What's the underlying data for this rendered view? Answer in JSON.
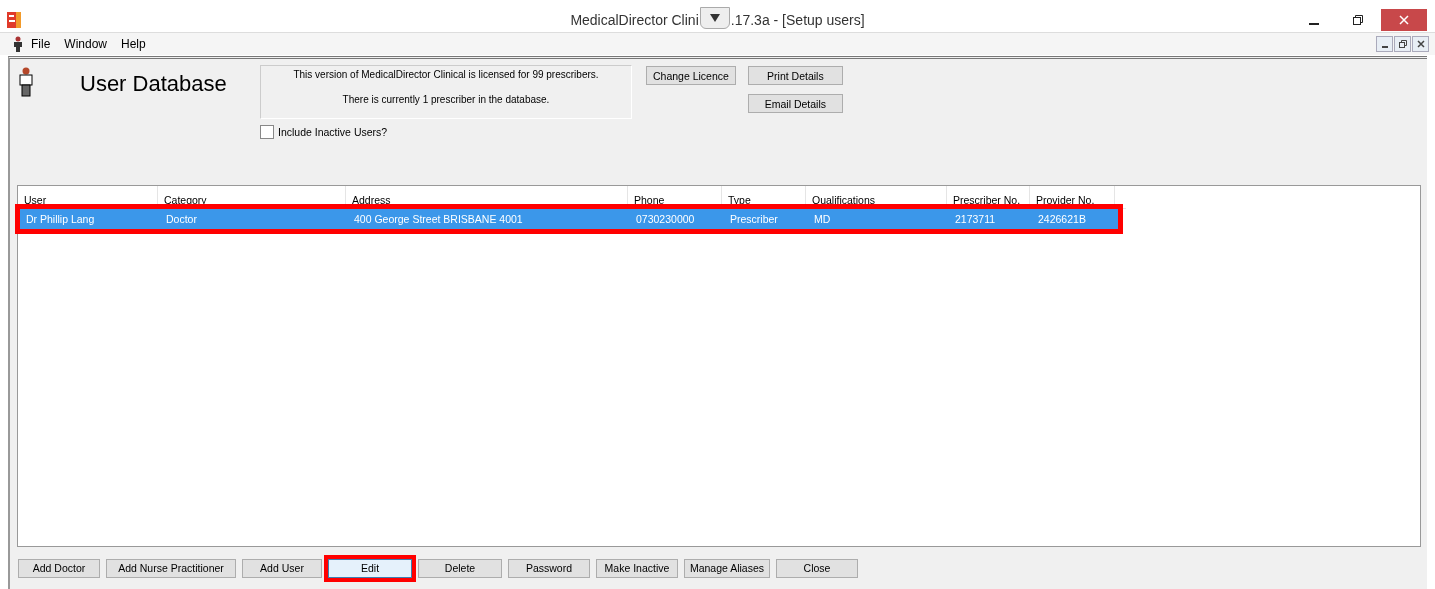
{
  "window": {
    "title_start": "MedicalDirector Clini",
    "title_end": ".17.3a - [Setup users]"
  },
  "menu": [
    "File",
    "Window",
    "Help"
  ],
  "header": {
    "title": "User Database",
    "licence_lines": [
      "This version of MedicalDirector Clinical is licensed for 99 prescribers.",
      "There is currently 1 prescriber in the database."
    ],
    "include_inactive": {
      "label": "Include Inactive Users?",
      "checked": false
    },
    "buttons": [
      "Change Licence",
      "Print Details",
      "Email Details"
    ]
  },
  "table": {
    "columns": [
      "User",
      "Category",
      "Address",
      "Phone",
      "Type",
      "Qualifications",
      "Prescriber No.",
      "Provider No."
    ],
    "rows": [
      {
        "cells": [
          "Dr Phillip Lang",
          "Doctor",
          "400 George Street  BRISBANE  4001",
          "0730230000",
          "Prescriber",
          "MD",
          "2173711",
          "2426621B"
        ],
        "selected": true,
        "highlighted": true
      }
    ]
  },
  "buttons": [
    {
      "label": "Add Doctor",
      "focused": false,
      "highlighted": false
    },
    {
      "label": "Add Nurse Practitioner",
      "focused": false,
      "highlighted": false
    },
    {
      "label": "Add User",
      "focused": false,
      "highlighted": false
    },
    {
      "label": "Edit",
      "focused": true,
      "highlighted": true
    },
    {
      "label": "Delete",
      "focused": false,
      "highlighted": false
    },
    {
      "label": "Password",
      "focused": false,
      "highlighted": false
    },
    {
      "label": "Make Inactive",
      "focused": false,
      "highlighted": false
    },
    {
      "label": "Manage Aliases",
      "focused": false,
      "highlighted": false
    },
    {
      "label": "Close",
      "focused": false,
      "highlighted": false
    }
  ]
}
